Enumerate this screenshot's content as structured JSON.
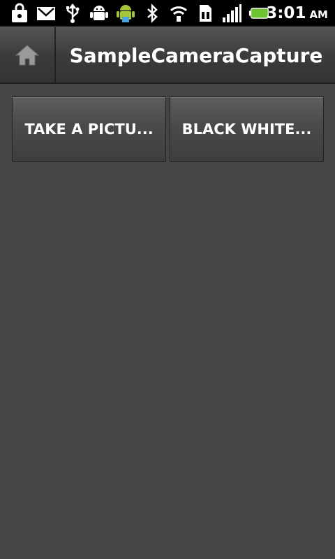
{
  "status_bar": {
    "icons": [
      "shopping-bag-icon",
      "gmail-icon",
      "usb-icon",
      "android-debug-icon",
      "android-market-icon",
      "bluetooth-icon",
      "wifi-icon",
      "sim-card-icon",
      "signal-icon",
      "battery-icon"
    ],
    "time": "3:01",
    "ampm": "AM",
    "battery_color": "#6cc22f"
  },
  "action_bar": {
    "title": "SampleCameraCapture"
  },
  "buttons": {
    "take_picture": "TAKE A PICTU...",
    "black_white": "BLACK WHITE..."
  }
}
